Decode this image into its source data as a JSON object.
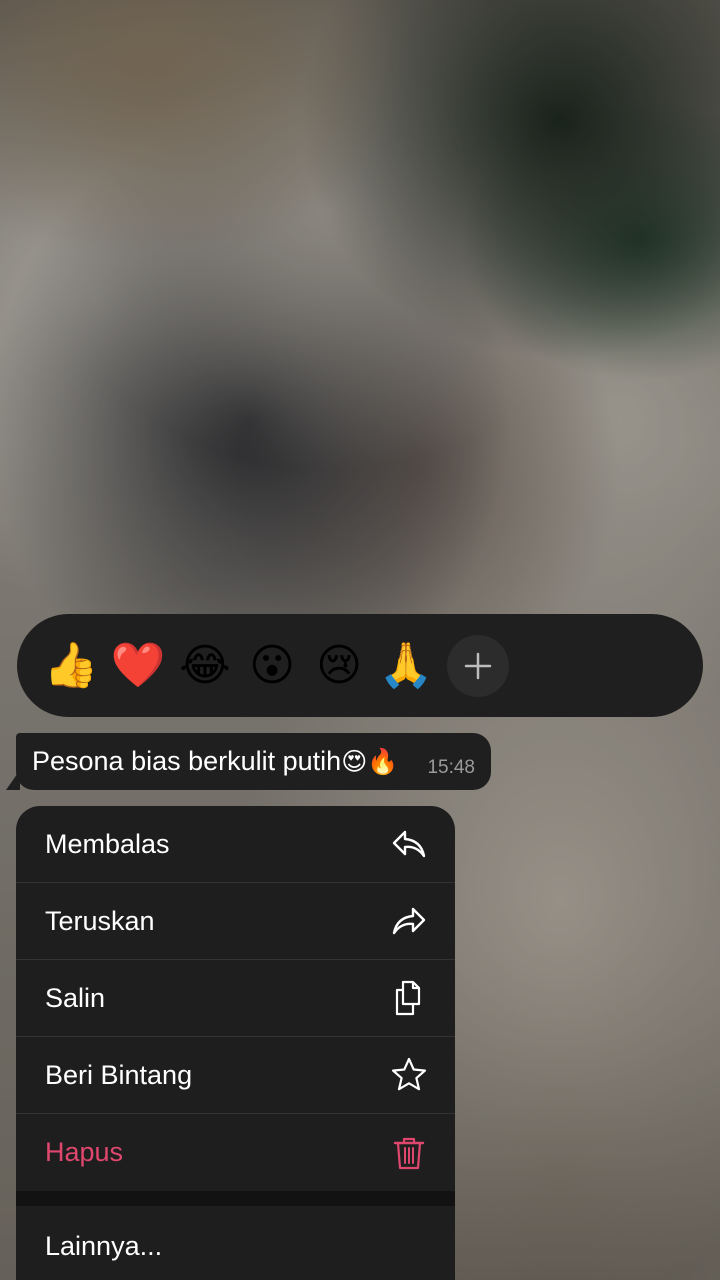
{
  "reactions": [
    {
      "emoji": "👍",
      "name": "thumbs-up"
    },
    {
      "emoji": "❤️",
      "name": "red-heart"
    },
    {
      "emoji": "😂",
      "name": "tears-of-joy"
    },
    {
      "emoji": "😮",
      "name": "surprised"
    },
    {
      "emoji": "😢",
      "name": "crying"
    },
    {
      "emoji": "🙏",
      "name": "folded-hands"
    }
  ],
  "add_reaction_icon": "plus-icon",
  "message": {
    "text": "Pesona bias berkulit putih",
    "emojis": "😍🔥",
    "time": "15:48"
  },
  "menu": {
    "reply": {
      "label": "Membalas",
      "icon": "reply-arrow-icon"
    },
    "forward": {
      "label": "Teruskan",
      "icon": "forward-arrow-icon"
    },
    "copy": {
      "label": "Salin",
      "icon": "copy-icon"
    },
    "star": {
      "label": "Beri Bintang",
      "icon": "star-icon"
    },
    "delete": {
      "label": "Hapus",
      "icon": "trash-icon"
    },
    "more": {
      "label": "Lainnya..."
    }
  },
  "colors": {
    "panel": "#1f1f1f",
    "danger": "#e0476e",
    "text": "#ffffff",
    "muted": "#9a9a9a"
  }
}
